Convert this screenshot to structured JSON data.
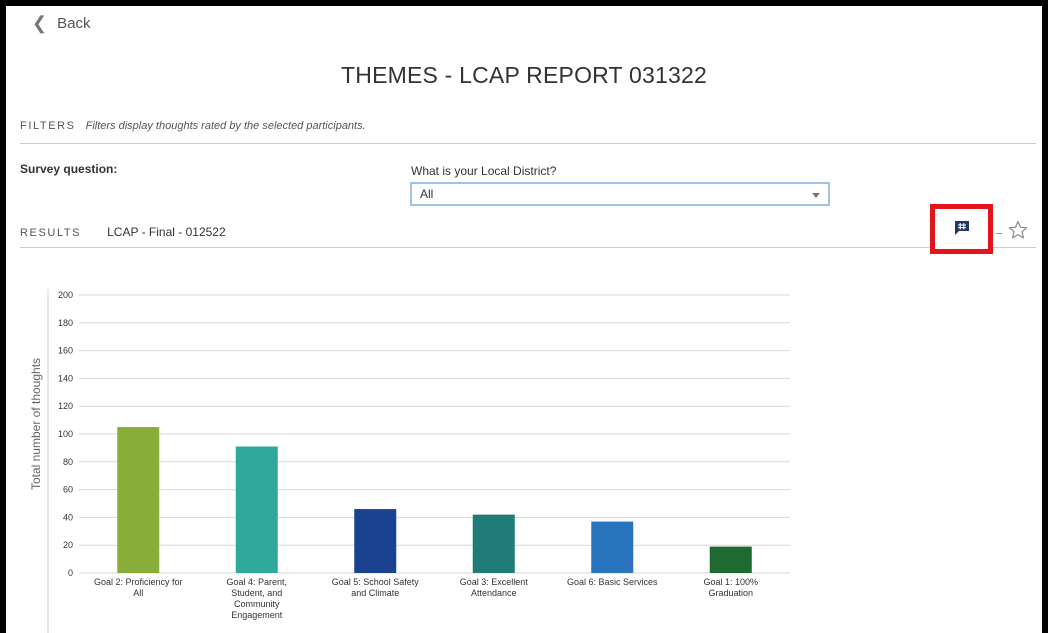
{
  "nav": {
    "back_label": "Back"
  },
  "page": {
    "title": "THEMES - LCAP REPORT 031322"
  },
  "filters": {
    "label": "FILTERS",
    "description": "Filters display thoughts rated by the selected participants.",
    "survey_question_label": "Survey question:",
    "district_question": "What is your Local District?",
    "district_value": "All"
  },
  "results": {
    "label": "RESULTS",
    "survey_name": "LCAP - Final - 012522"
  },
  "icons": {
    "chat": "chat-hashtag-icon",
    "star": "star-outline-icon"
  },
  "colors": {
    "highlight": "#e4141b",
    "select_border": "#9fc3e8"
  },
  "chart_data": {
    "type": "bar",
    "ylabel": "Total number of thoughts",
    "ylim": [
      0,
      200
    ],
    "yticks": [
      0,
      20,
      40,
      60,
      80,
      100,
      120,
      140,
      160,
      180,
      200
    ],
    "grid": true,
    "categories": [
      [
        "Goal 2: Proficiency for",
        "All"
      ],
      [
        "Goal 4: Parent,",
        "Student, and",
        "Community",
        "Engagement"
      ],
      [
        "Goal 5: School Safety",
        "and Climate"
      ],
      [
        "Goal 3: Excellent",
        "Attendance"
      ],
      [
        "Goal 6: Basic Services"
      ],
      [
        "Goal 1: 100%",
        "Graduation"
      ]
    ],
    "values": [
      105,
      91,
      46,
      42,
      37,
      19
    ],
    "colors": [
      "#8aad3a",
      "#2fa99c",
      "#1a4291",
      "#207c78",
      "#2a74bd",
      "#1f6a32"
    ]
  }
}
